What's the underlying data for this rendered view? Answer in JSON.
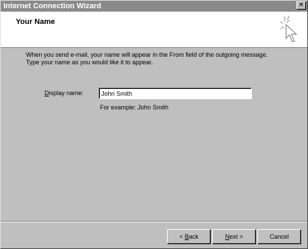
{
  "window": {
    "title": "Internet Connection Wizard",
    "close_glyph": "✕"
  },
  "header": {
    "title": "Your Name",
    "icon": "wizard-cursor-sparkle-icon"
  },
  "intro": {
    "line1": "When you send e-mail, your name will appear in the From field of the outgoing message.",
    "line2": "Type your name as you would like it to appear."
  },
  "form": {
    "display_name_label_prefix": "D",
    "display_name_label_rest": "isplay name:",
    "display_name_value": "John Smith",
    "example_text": "For example: John Smith"
  },
  "buttons": {
    "back_prefix": "< ",
    "back_accel": "B",
    "back_rest": "ack",
    "next_accel": "N",
    "next_rest": "ext >",
    "cancel_label": "Cancel"
  }
}
